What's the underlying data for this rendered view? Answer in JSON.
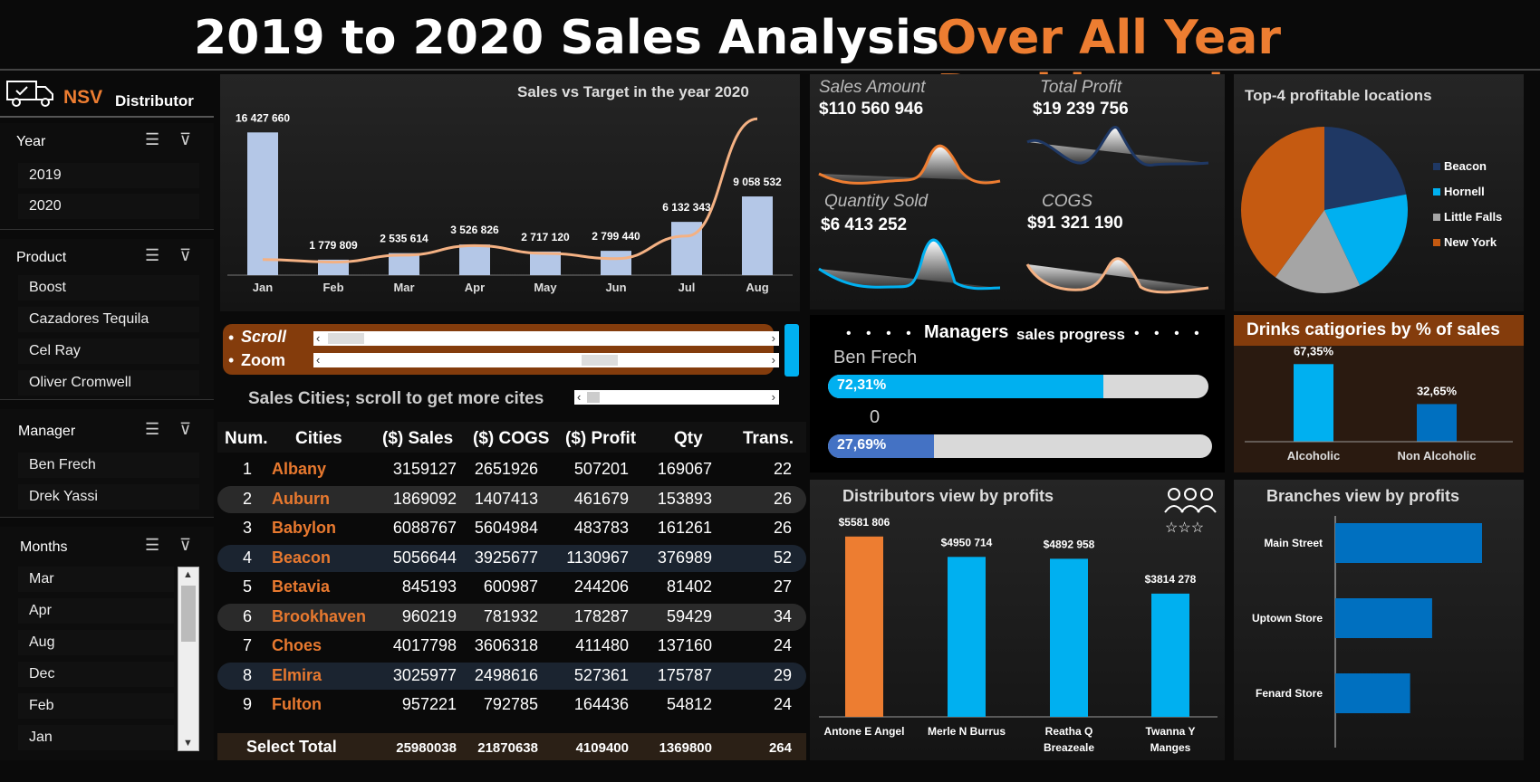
{
  "title_left": "2019 to 2020 Sales Analysis",
  "title_right": "Over All Year Dashboard",
  "brand": {
    "name_accent": "NSV",
    "name": "Distributor"
  },
  "slicers": {
    "year": {
      "label": "Year",
      "items": [
        "2019",
        "2020"
      ]
    },
    "product": {
      "label": "Product",
      "items": [
        "Boost",
        "Cazadores Tequila",
        "Cel Ray",
        "Oliver Cromwell"
      ]
    },
    "manager": {
      "label": "Manager",
      "items": [
        "Ben Frech",
        "Drek Yassi"
      ]
    },
    "months": {
      "label": "Months",
      "items": [
        "Mar",
        "Apr",
        "Aug",
        "Dec",
        "Feb",
        "Jan"
      ]
    }
  },
  "scroll_zoom": {
    "scroll_label": "Scroll",
    "zoom_label": "Zoom"
  },
  "cities_caption": "Sales Cities; scroll to get more cites",
  "table": {
    "headers": [
      "Num.",
      "Cities",
      "($) Sales",
      "($) COGS",
      "($) Profit",
      "Qty",
      "Trans."
    ],
    "rows": [
      [
        "1",
        "Albany",
        "3159127",
        "2651926",
        "507201",
        "169067",
        "22"
      ],
      [
        "2",
        "Auburn",
        "1869092",
        "1407413",
        "461679",
        "153893",
        "26"
      ],
      [
        "3",
        "Babylon",
        "6088767",
        "5604984",
        "483783",
        "161261",
        "26"
      ],
      [
        "4",
        "Beacon",
        "5056644",
        "3925677",
        "1130967",
        "376989",
        "52"
      ],
      [
        "5",
        "Betavia",
        "845193",
        "600987",
        "244206",
        "81402",
        "27"
      ],
      [
        "6",
        "Brookhaven",
        "960219",
        "781932",
        "178287",
        "59429",
        "34"
      ],
      [
        "7",
        "Choes",
        "4017798",
        "3606318",
        "411480",
        "137160",
        "24"
      ],
      [
        "8",
        "Elmira",
        "3025977",
        "2498616",
        "527361",
        "175787",
        "29"
      ],
      [
        "9",
        "Fulton",
        "957221",
        "792785",
        "164436",
        "54812",
        "24"
      ]
    ],
    "total": [
      "Select Total",
      "25980038",
      "21870638",
      "4109400",
      "1369800",
      "264"
    ]
  },
  "kpis": {
    "sales_label": "Sales Amount",
    "sales_value": "$110 560 946",
    "profit_label": "Total Profit",
    "profit_value": "$19 239 756",
    "qty_label": "Quantity Sold",
    "qty_value": "$6 413 252",
    "cogs_label": "COGS",
    "cogs_value": "$91 321 190"
  },
  "managers": {
    "title_bold": "Managers",
    "title_rest": "sales progress",
    "bar1_name": "Ben Frech",
    "bar1_label": "72,31%",
    "bar1_value": 0.7231,
    "bar2_name": "0",
    "bar2_label": "27,69%",
    "bar2_value": 0.2769,
    "dots": "• • • •"
  },
  "colors": {
    "orange": "#ed7d31",
    "blue": "#00b0f0",
    "bar": "#b4c7e7",
    "navy": "#1f3864",
    "brown": "#843c0c",
    "dark_blue": "#0070c0",
    "progress_blue2": "#4472c4"
  },
  "chart_data": [
    {
      "type": "bar",
      "title": "Sales vs Target in the year 2020",
      "categories": [
        "Jan",
        "Feb",
        "Mar",
        "Apr",
        "May",
        "Jun",
        "Jul",
        "Aug"
      ],
      "values": [
        16427660,
        1779809,
        2535614,
        3526826,
        2717120,
        2799440,
        6132343,
        9058532
      ],
      "labels": [
        "16 427 660",
        "1 779 809",
        "2 535 614",
        "3 526 826",
        "2 717 120",
        "2 799 440",
        "6 132 343",
        "9 058 532"
      ],
      "target_line": [
        1800000,
        1500000,
        2300000,
        3400000,
        2500000,
        1900000,
        4500000,
        18000000
      ],
      "ylim": [
        0,
        20000000
      ]
    },
    {
      "type": "pie",
      "title": "Top-4 profitable locations",
      "labels": [
        "Beacon",
        "Hornell",
        "Little Falls",
        "New York"
      ],
      "values": [
        22,
        21,
        17,
        40
      ],
      "colors": [
        "#1f3864",
        "#00b0f0",
        "#a5a5a5",
        "#c55a11"
      ],
      "legend": "right"
    },
    {
      "type": "bar",
      "title": "Drinks catigories by % of sales",
      "categories": [
        "Alcoholic",
        "Non Alcoholic"
      ],
      "values": [
        67.35,
        32.65
      ],
      "labels": [
        "67,35%",
        "32,65%"
      ],
      "ylim": [
        0,
        100
      ]
    },
    {
      "type": "bar",
      "title": "Distributors view by profits",
      "categories": [
        "Antone E Angel",
        "Merle N Burrus",
        "Reatha Q Breazeale",
        "Twanna Y Manges"
      ],
      "values": [
        5581806,
        4950714,
        4892958,
        3814278
      ],
      "labels": [
        "$5581 806",
        "$4950 714",
        "$4892 958",
        "$3814 278"
      ],
      "ylim": [
        0,
        6500000
      ]
    },
    {
      "type": "bar",
      "title": "Branches view by profits",
      "orientation": "horizontal",
      "categories": [
        "Main Street",
        "Uptown Store",
        "Fenard Store"
      ],
      "values": [
        100,
        66,
        51
      ]
    }
  ]
}
